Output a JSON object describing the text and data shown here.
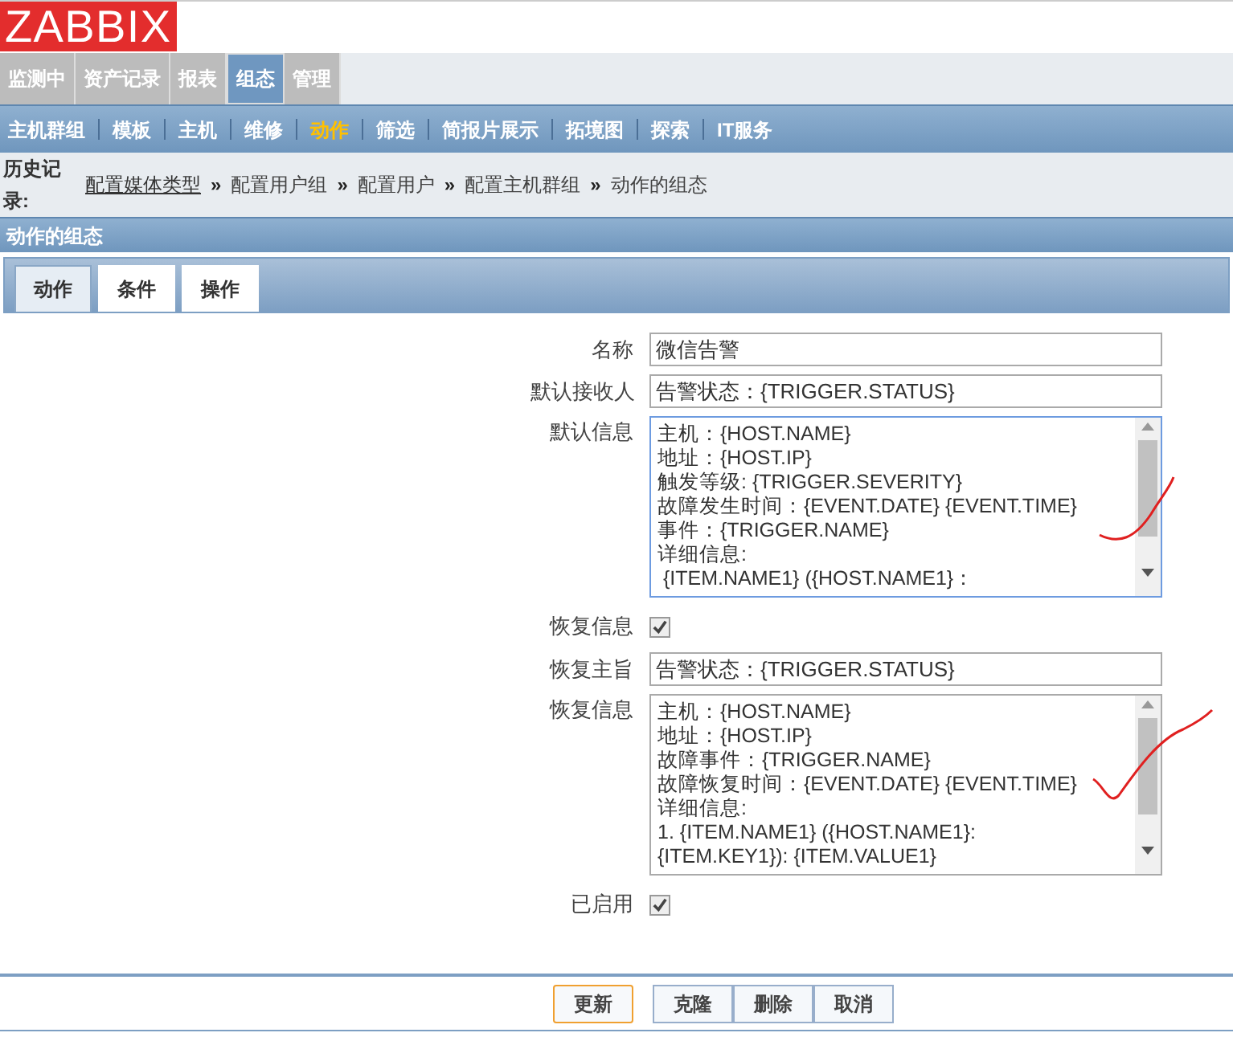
{
  "logo": "ZABBIX",
  "main_menu": [
    {
      "label": "监测中",
      "selected": false
    },
    {
      "label": "资产记录",
      "selected": false
    },
    {
      "label": "报表",
      "selected": false
    },
    {
      "label": "组态",
      "selected": true
    },
    {
      "label": "管理",
      "selected": false
    }
  ],
  "sub_menu": [
    {
      "label": "主机群组",
      "selected": false
    },
    {
      "label": "模板",
      "selected": false
    },
    {
      "label": "主机",
      "selected": false
    },
    {
      "label": "维修",
      "selected": false
    },
    {
      "label": "动作",
      "selected": true
    },
    {
      "label": "筛选",
      "selected": false
    },
    {
      "label": "简报片展示",
      "selected": false
    },
    {
      "label": "拓境图",
      "selected": false
    },
    {
      "label": "探索",
      "selected": false
    },
    {
      "label": "IT服务",
      "selected": false
    }
  ],
  "history": {
    "label": "历史记录:",
    "separator": "»",
    "items": [
      {
        "label": "配置媒体类型",
        "kind": "link"
      },
      {
        "label": "配置用户组",
        "kind": "text"
      },
      {
        "label": "配置用户",
        "kind": "text"
      },
      {
        "label": "配置主机群组",
        "kind": "text"
      },
      {
        "label": "动作的组态",
        "kind": "text"
      }
    ]
  },
  "section_title": "动作的组态",
  "tabs": [
    {
      "label": "动作",
      "selected": true
    },
    {
      "label": "条件",
      "selected": false
    },
    {
      "label": "操作",
      "selected": false
    }
  ],
  "form": [
    {
      "kind": "input",
      "label": "名称",
      "value": "微信告警"
    },
    {
      "kind": "input",
      "label": "默认接收人",
      "value": "告警状态：{TRIGGER.STATUS}"
    },
    {
      "kind": "textarea",
      "label": "默认信息",
      "focused": true,
      "lines": [
        "主机：{HOST.NAME}",
        "地址：{HOST.IP}",
        "触发等级: {TRIGGER.SEVERITY}",
        "故障发生时间：{EVENT.DATE} {EVENT.TIME}",
        "事件：{TRIGGER.NAME}",
        "详细信息:",
        " {ITEM.NAME1} ({HOST.NAME1}："
      ]
    },
    {
      "kind": "checkbox",
      "label": "恢复信息",
      "checked": true
    },
    {
      "kind": "input",
      "label": "恢复主旨",
      "value": "告警状态：{TRIGGER.STATUS}"
    },
    {
      "kind": "textarea",
      "label": "恢复信息",
      "focused": false,
      "lines": [
        "主机：{HOST.NAME}",
        "地址：{HOST.IP}",
        "故障事件：{TRIGGER.NAME}",
        "故障恢复时间：{EVENT.DATE} {EVENT.TIME}",
        "详细信息:",
        "1. {ITEM.NAME1} ({HOST.NAME1}:",
        "{ITEM.KEY1}): {ITEM.VALUE1}"
      ]
    },
    {
      "kind": "checkbox",
      "label": "已启用",
      "checked": true
    }
  ],
  "buttons": [
    {
      "label": "更新",
      "primary": true
    },
    {
      "label": "克隆",
      "primary": false
    },
    {
      "label": "删除",
      "primary": false
    },
    {
      "label": "取消",
      "primary": false
    }
  ]
}
